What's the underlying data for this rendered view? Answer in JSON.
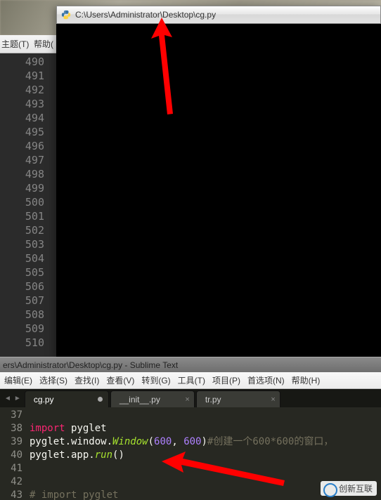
{
  "background_menu": {
    "items": [
      "主题(T)",
      "帮助("
    ]
  },
  "background_gutter_lines": [
    490,
    491,
    492,
    493,
    494,
    495,
    496,
    497,
    498,
    499,
    500,
    501,
    502,
    503,
    504,
    505,
    506,
    507,
    508,
    509,
    510
  ],
  "pyglet": {
    "title": "C:\\Users\\Administrator\\Desktop\\cg.py",
    "icon_name": "python-icon"
  },
  "sublime": {
    "title_suffix": "ers\\Administrator\\Desktop\\cg.py - Sublime Text",
    "menu": [
      "编辑(E)",
      "选择(S)",
      "查找(I)",
      "查看(V)",
      "转到(G)",
      "工具(T)",
      "项目(P)",
      "首选项(N)",
      "帮助(H)"
    ],
    "tabs": [
      {
        "label": "cg.py",
        "active": true,
        "dirty": true
      },
      {
        "label": "__init__.py",
        "active": false,
        "dirty": false
      },
      {
        "label": "tr.py",
        "active": false,
        "dirty": false
      }
    ],
    "code": {
      "start": 37,
      "lines": [
        {
          "n": 37,
          "text": ""
        },
        {
          "n": 38,
          "kw": "import",
          "mod": "pyglet"
        },
        {
          "n": 39,
          "head": "pyglet.window.",
          "cls": "Window",
          "args": [
            "600",
            "600"
          ],
          "comment": "#创建一个600*600的窗口，"
        },
        {
          "n": 40,
          "head": "pyglet.app.",
          "cls": "run",
          "args": []
        },
        {
          "n": 41,
          "text": ""
        },
        {
          "n": 42,
          "text": ""
        },
        {
          "n": 43,
          "comment_only": "# import pyglet"
        }
      ]
    }
  },
  "watermark": "创新互联"
}
